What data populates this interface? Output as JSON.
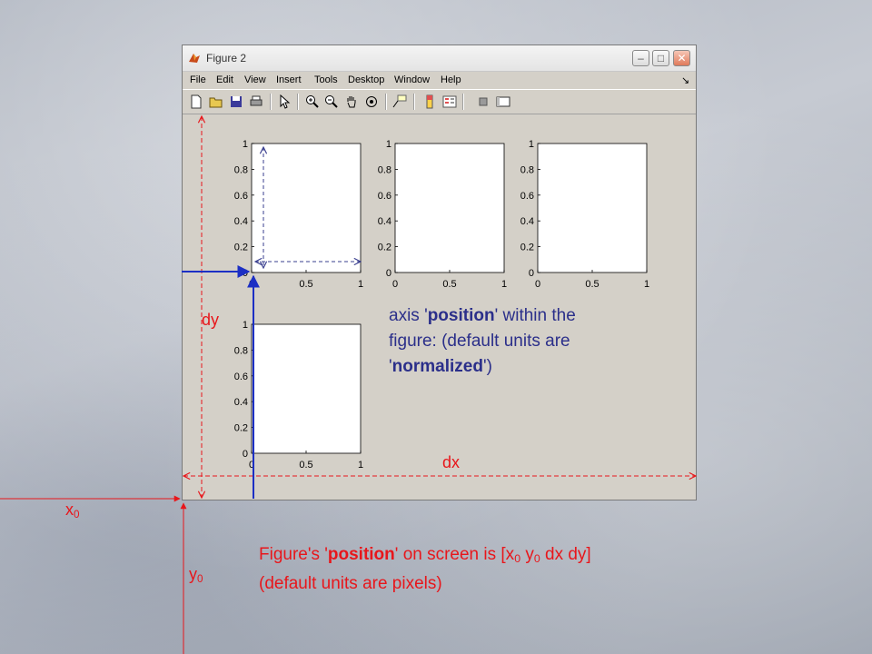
{
  "window": {
    "title": "Figure 2",
    "controls": {
      "minimize": "–",
      "maximize": "□",
      "close": "✕"
    },
    "menu": [
      "File",
      "Edit",
      "View",
      "Insert",
      "Tools",
      "Desktop",
      "Window",
      "Help"
    ],
    "menu_arrow": "↘",
    "toolbar_icons": [
      "new-file-icon",
      "open-folder-icon",
      "save-icon",
      "print-icon",
      "pointer-icon",
      "zoom-in-icon",
      "zoom-out-icon",
      "pan-hand-icon",
      "rotate-3d-icon",
      "data-cursor-icon",
      "colorbar-icon",
      "legend-icon",
      "hide-plot-tools-icon",
      "show-plot-tools-icon"
    ]
  },
  "axes": [
    {
      "ticks_y": [
        "1",
        "0.8",
        "0.6",
        "0.4",
        "0.2",
        "0"
      ],
      "ticks_x": [
        "0",
        "0.5",
        "1"
      ]
    },
    {
      "ticks_y": [
        "1",
        "0.8",
        "0.6",
        "0.4",
        "0.2",
        "0"
      ],
      "ticks_x": [
        "0",
        "0.5",
        "1"
      ]
    },
    {
      "ticks_y": [
        "1",
        "0.8",
        "0.6",
        "0.4",
        "0.2",
        "0"
      ],
      "ticks_x": [
        "0",
        "0.5",
        "1"
      ]
    },
    {
      "ticks_y": [
        "1",
        "0.8",
        "0.6",
        "0.4",
        "0.2",
        "0"
      ],
      "ticks_x": [
        "0",
        "0.5",
        "1"
      ]
    }
  ],
  "annotations": {
    "dy": "dy",
    "dx": "dx",
    "x0_main": "x",
    "x0_sub": "0",
    "y0_main": "y",
    "y0_sub": "0",
    "axis_note": {
      "l1_a": "axis '",
      "l1_b": "position",
      "l1_c": "' within the",
      "l2": "figure: (default units are",
      "l3_a": "'",
      "l3_b": "normalized",
      "l3_c": "')"
    },
    "fig_note": {
      "a": "Figure's '",
      "b": "position",
      "c": "' on screen is [x",
      "d": "0",
      "e": " y",
      "f": "0",
      "g": " dx dy]",
      "line2": "(default units are pixels)"
    }
  },
  "colors": {
    "red": "#e8161b",
    "blue": "#1c2fc4",
    "note_blue": "#2b2f8a"
  }
}
